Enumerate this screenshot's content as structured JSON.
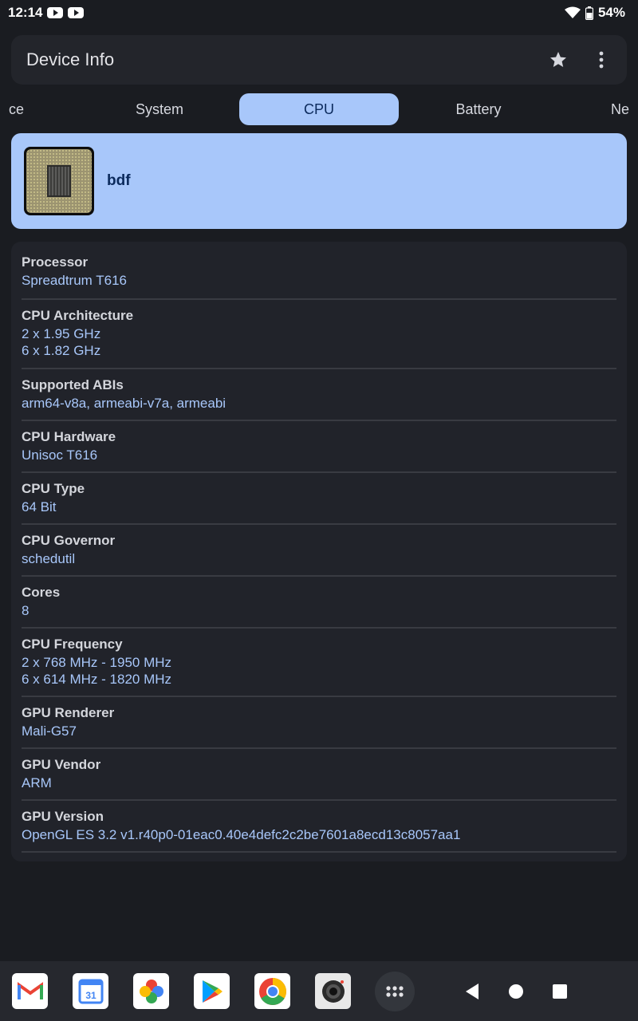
{
  "status_bar": {
    "time": "12:14",
    "battery": "54%"
  },
  "app_bar": {
    "title": "Device Info"
  },
  "tabs": [
    {
      "label": "ce"
    },
    {
      "label": "System"
    },
    {
      "label": "CPU"
    },
    {
      "label": "Battery"
    },
    {
      "label": "Ne"
    }
  ],
  "cpu_card": {
    "name": "bdf"
  },
  "info": [
    {
      "label": "Processor",
      "value": "Spreadtrum T616"
    },
    {
      "label": "CPU Architecture",
      "value": "2 x 1.95 GHz\n6 x 1.82 GHz"
    },
    {
      "label": "Supported ABIs",
      "value": "arm64-v8a, armeabi-v7a, armeabi"
    },
    {
      "label": "CPU Hardware",
      "value": "Unisoc T616"
    },
    {
      "label": "CPU Type",
      "value": "64 Bit"
    },
    {
      "label": "CPU Governor",
      "value": "schedutil"
    },
    {
      "label": "Cores",
      "value": "8"
    },
    {
      "label": "CPU Frequency",
      "value": "2 x 768 MHz - 1950 MHz\n6 x 614 MHz - 1820 MHz"
    },
    {
      "label": "GPU Renderer",
      "value": "Mali-G57"
    },
    {
      "label": "GPU Vendor",
      "value": "ARM"
    },
    {
      "label": "GPU Version",
      "value": "OpenGL ES 3.2 v1.r40p0-01eac0.40e4defc2c2be7601a8ecd13c8057aa1"
    }
  ],
  "dock": {
    "apps": [
      "gmail-icon",
      "calendar-icon",
      "photos-icon",
      "play-store-icon",
      "chrome-icon",
      "camera-icon"
    ],
    "calendar_day": "31"
  },
  "colors": {
    "accent": "#a8c7fa",
    "background": "#1a1c21",
    "card": "#21232a"
  }
}
